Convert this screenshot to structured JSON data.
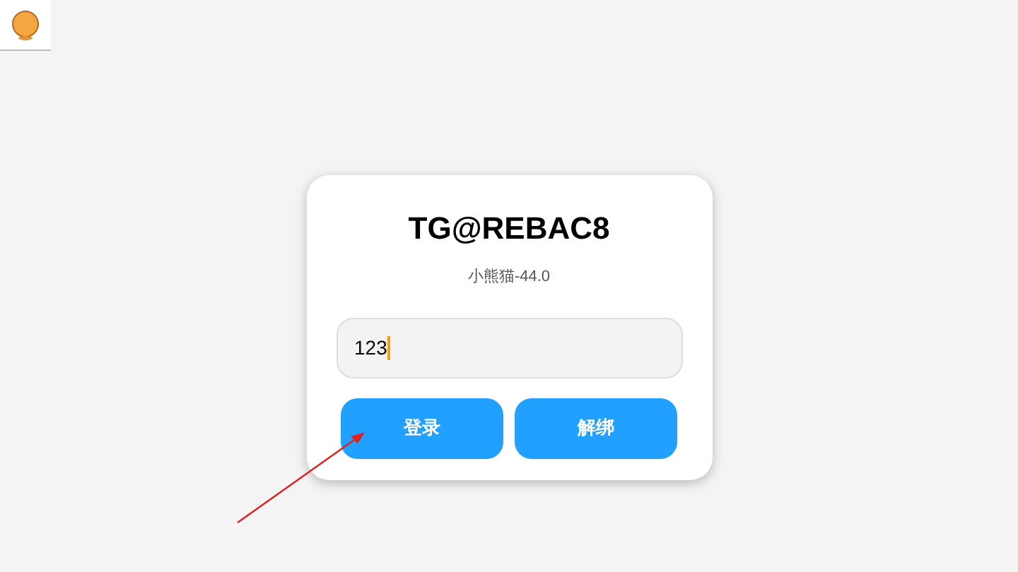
{
  "login_card": {
    "title": "TG@REBAC8",
    "subtitle": "小熊猫-44.0",
    "input": {
      "value": "123",
      "focused": true
    },
    "buttons": [
      {
        "label": "登录"
      },
      {
        "label": "解绑"
      }
    ]
  }
}
